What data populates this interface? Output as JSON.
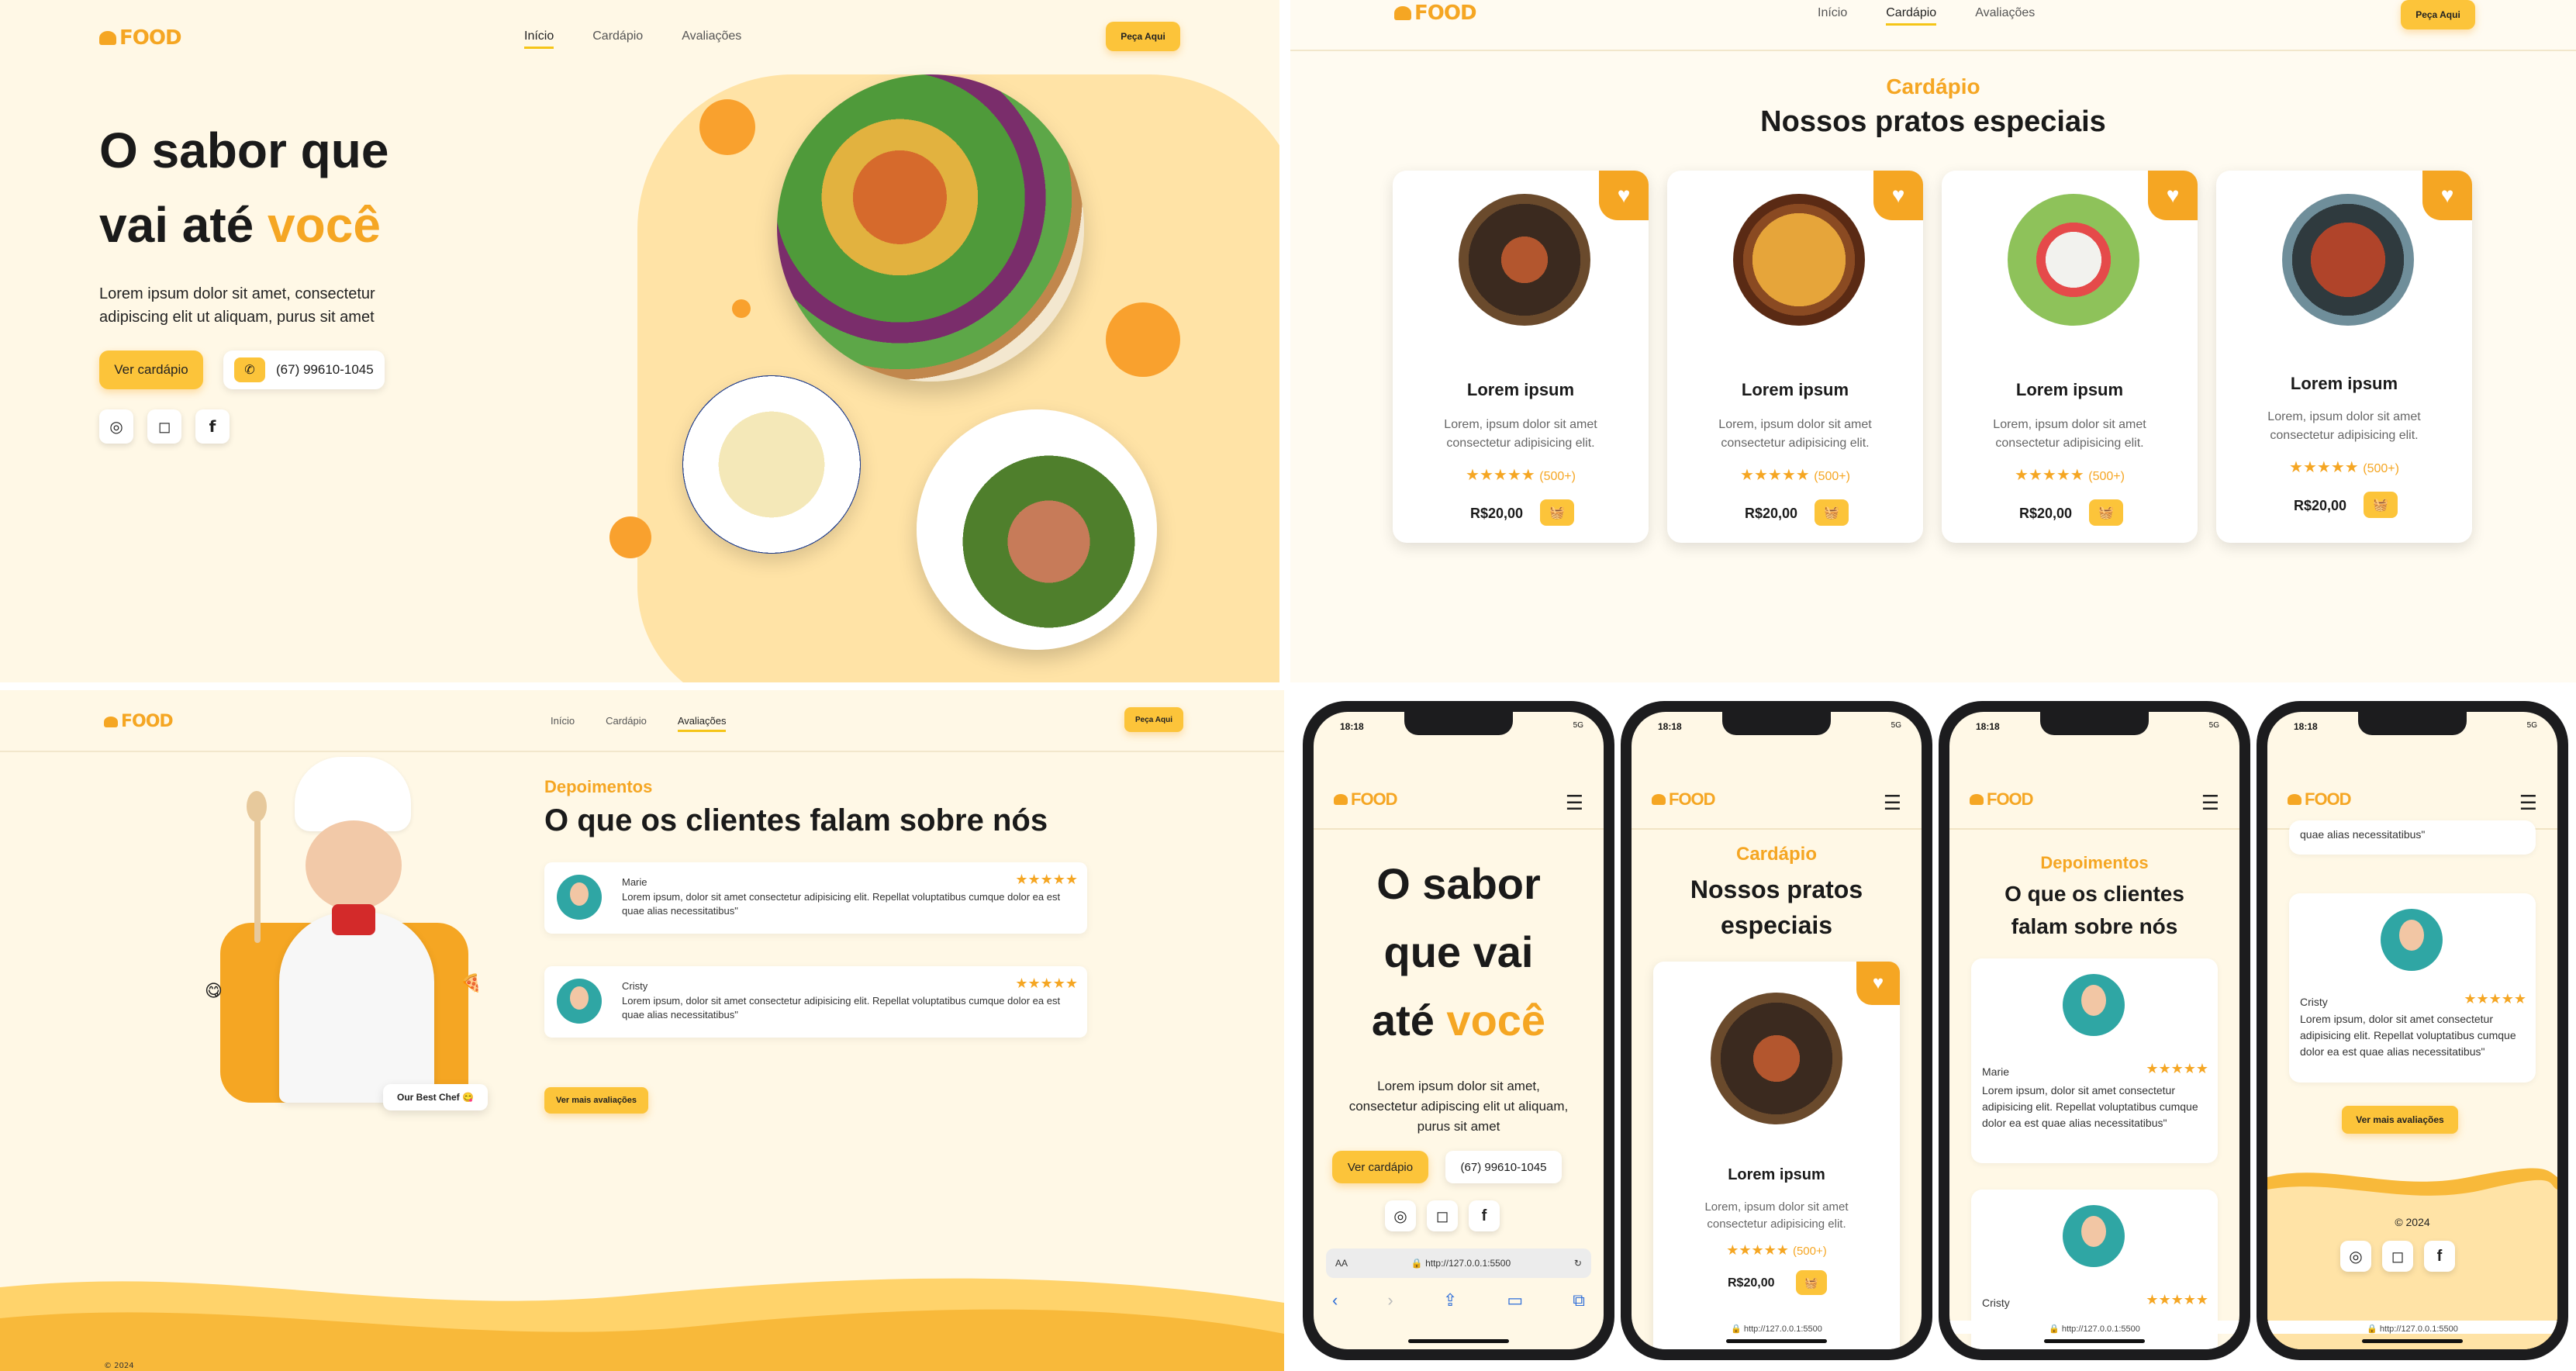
{
  "brand": {
    "logo_text": "FOOD",
    "accent": "#f5a623",
    "yellow": "#fcc43a",
    "cream": "#fff8e6"
  },
  "nav": {
    "home": "Início",
    "menu": "Cardápio",
    "reviews": "Avaliações",
    "cta": "Peça Aqui"
  },
  "hero": {
    "line1": "O sabor que",
    "line2_prefix": "vai até ",
    "highlight": "você",
    "desc": "Lorem ipsum dolor sit amet, consectetur adipiscing elit ut aliquam, purus sit amet",
    "btn_menu": "Ver cardápio",
    "phone": "(67) 99610-1045",
    "icons": [
      "whatsapp-icon",
      "instagram-icon",
      "facebook-icon"
    ]
  },
  "menu_section": {
    "kicker": "Cardápio",
    "title": "Nossos pratos especiais",
    "cards": [
      {
        "title": "Lorem ipsum",
        "desc": "Lorem, ipsum dolor sit amet consectetur adipisicing elit.",
        "stars": "★★★★★",
        "count": "(500+)",
        "price": "R$20,00"
      },
      {
        "title": "Lorem ipsum",
        "desc": "Lorem, ipsum dolor sit amet consectetur adipisicing elit.",
        "stars": "★★★★★",
        "count": "(500+)",
        "price": "R$20,00"
      },
      {
        "title": "Lorem ipsum",
        "desc": "Lorem, ipsum dolor sit amet consectetur adipisicing elit.",
        "stars": "★★★★★",
        "count": "(500+)",
        "price": "R$20,00"
      },
      {
        "title": "Lorem ipsum",
        "desc": "Lorem, ipsum dolor sit amet consectetur adipisicing elit.",
        "stars": "★★★★★",
        "count": "(500+)",
        "price": "R$20,00"
      }
    ]
  },
  "testimonials": {
    "kicker": "Depoimentos",
    "title": "O que os clientes falam sobre nós",
    "chef_tag": "Our Best Chef 😋",
    "reviews": [
      {
        "name": "Marie",
        "stars": "★★★★★",
        "text": "Lorem ipsum, dolor sit amet consectetur adipisicing elit. Repellat voluptatibus cumque dolor ea est quae alias necessitatibus\""
      },
      {
        "name": "Cristy",
        "stars": "★★★★★",
        "text": "Lorem ipsum, dolor sit amet consectetur adipisicing elit. Repellat voluptatibus cumque dolor ea est quae alias necessitatibus\""
      }
    ],
    "more_btn": "Ver mais avaliações",
    "copyright": "© 2024"
  },
  "mobile": {
    "time": "18:18",
    "signal": "5G",
    "url": "http://127.0.0.1:5500",
    "hero_l1": "O sabor",
    "hero_l2": "que vai",
    "hero_l3_prefix": "até ",
    "testi_title_l1": "O que os clientes",
    "testi_title_l2": "falam sobre nós",
    "menu_title_l1": "Nossos pratos",
    "menu_title_l2": "especiais",
    "tail_text": "quae alias necessitatibus\"",
    "aa": "AA"
  }
}
